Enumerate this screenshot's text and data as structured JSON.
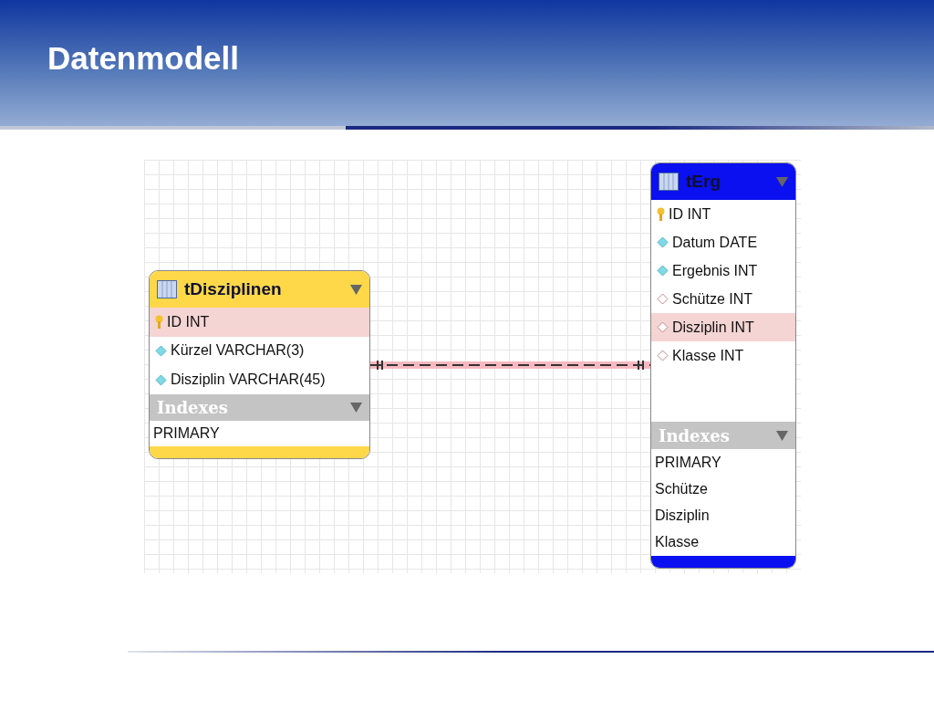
{
  "slide_title": "Datenmodell",
  "diagram": {
    "tables": [
      {
        "name": "tDisziplinen",
        "color": "#ffd84a",
        "columns": [
          {
            "kind": "primary",
            "label": "ID INT",
            "selected": true
          },
          {
            "kind": "column",
            "label": "Kürzel VARCHAR(3)",
            "selected": false
          },
          {
            "kind": "column",
            "label": "Disziplin VARCHAR(45)",
            "selected": false
          }
        ],
        "indexes_heading": "Indexes",
        "indexes": [
          "PRIMARY"
        ]
      },
      {
        "name": "tErg",
        "color": "#0a10f0",
        "columns": [
          {
            "kind": "primary",
            "label": "ID INT",
            "selected": false
          },
          {
            "kind": "column",
            "label": "Datum DATE",
            "selected": false
          },
          {
            "kind": "column",
            "label": "Ergebnis INT",
            "selected": false
          },
          {
            "kind": "foreign",
            "label": "Schütze INT",
            "selected": false
          },
          {
            "kind": "foreign",
            "label": "Disziplin INT",
            "selected": true
          },
          {
            "kind": "foreign",
            "label": "Klasse INT",
            "selected": false
          }
        ],
        "indexes_heading": "Indexes",
        "indexes": [
          "PRIMARY",
          "Schütze",
          "Disziplin",
          "Klasse"
        ]
      }
    ]
  }
}
